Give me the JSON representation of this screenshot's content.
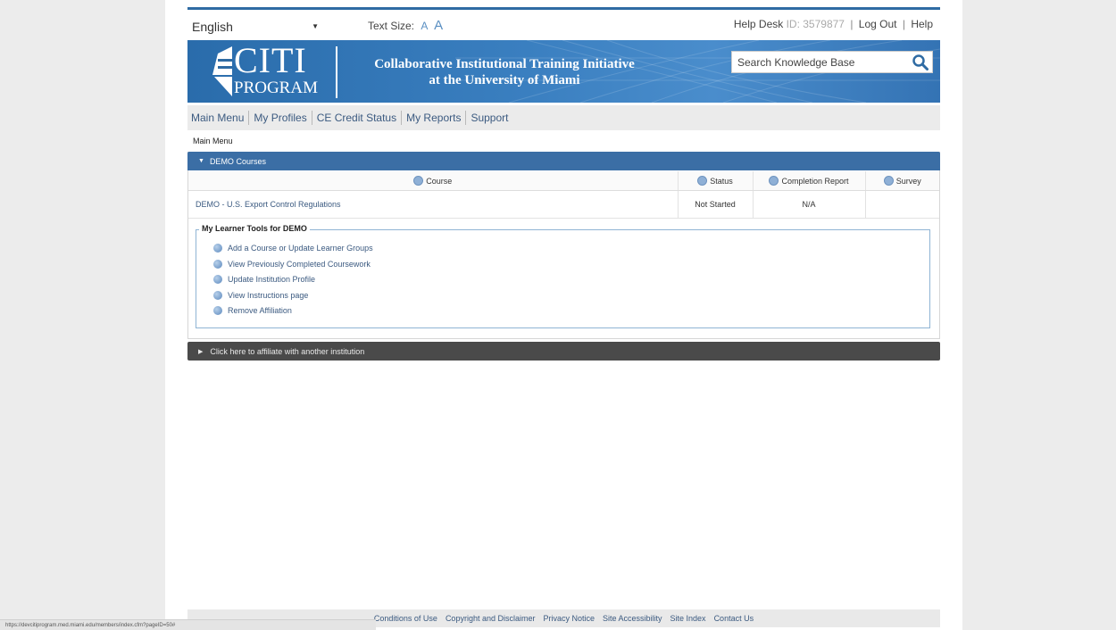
{
  "top": {
    "language": "English",
    "text_size_label": "Text Size:",
    "text_size_small": "A",
    "text_size_large": "A",
    "help_desk_label": "Help Desk",
    "help_desk_id": "ID: 3579877",
    "logout_label": "Log Out",
    "help_label": "Help"
  },
  "banner": {
    "logo_top": "CITI",
    "logo_bottom": "PROGRAM",
    "title_line1": "Collaborative Institutional Training Initiative",
    "title_line2": "at the University of Miami",
    "search_placeholder": "Search Knowledge Base"
  },
  "nav": {
    "items": [
      "Main Menu",
      "My Profiles",
      "CE Credit Status",
      "My Reports",
      "Support"
    ]
  },
  "breadcrumb": "Main Menu",
  "courses": {
    "header": "DEMO Courses",
    "columns": [
      "Course",
      "Status",
      "Completion Report",
      "Survey"
    ],
    "rows": [
      {
        "course": "DEMO - U.S. Export Control Regulations",
        "status": "Not Started",
        "completion": "N/A",
        "survey": ""
      }
    ]
  },
  "tools": {
    "legend": "My Learner Tools for DEMO",
    "items": [
      "Add a Course or Update Learner Groups",
      "View Previously Completed Coursework",
      "Update Institution Profile",
      "View Instructions page",
      "Remove Affiliation"
    ]
  },
  "affiliate": "Click here to affiliate with another institution",
  "footer": {
    "links": [
      "Conditions of Use",
      "Copyright and Disclaimer",
      "Privacy Notice",
      "Site Accessibility",
      "Site Index",
      "Contact Us"
    ]
  },
  "status_url": "https://devcitiprogram.med.miami.edu/members/index.cfm?pageID=50#",
  "colors": {
    "brand_blue": "#2f6ba3",
    "link_blue": "#3b5a80",
    "dark_bar": "#4a4a4a"
  }
}
